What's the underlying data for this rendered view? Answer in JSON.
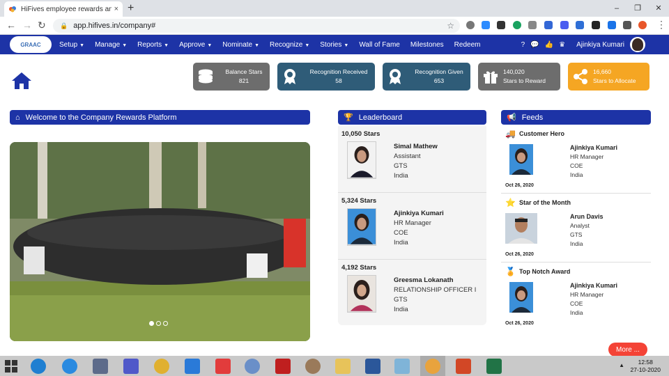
{
  "browser": {
    "tab_title": "HiFives employee rewards and re",
    "tab_close": "×",
    "new_tab": "+",
    "url": "app.hifives.in/company#",
    "window_controls": [
      "–",
      "❐",
      "✕"
    ]
  },
  "nav": {
    "logo_text": "GRAAC",
    "menu": [
      "Setup",
      "Manage",
      "Reports",
      "Approve",
      "Nominate",
      "Recognize",
      "Stories",
      "Wall of Fame",
      "Milestones",
      "Redeem"
    ],
    "menu_with_caret": [
      true,
      true,
      true,
      true,
      true,
      true,
      true,
      false,
      false,
      false
    ],
    "user_name": "Ajinkiya Kumari"
  },
  "stats": [
    {
      "label": "Balance Stars",
      "value": "821",
      "color": "#6d6d6d",
      "icon": "coins-icon"
    },
    {
      "label": "Recognition Received",
      "value": "58",
      "color": "#2f5c78",
      "icon": "award-icon"
    },
    {
      "label": "Recognition Given",
      "value": "653",
      "color": "#2f5c78",
      "icon": "award-icon"
    },
    {
      "label": "140,020",
      "value": "Stars to Reward",
      "color": "#6d6d6d",
      "icon": "gift-icon"
    },
    {
      "label": "16,660",
      "value": "Stars to Allocate",
      "color": "#f5a623",
      "icon": "share-icon"
    }
  ],
  "welcome": {
    "title": "Welcome to the Company Rewards Platform"
  },
  "leaderboard": {
    "title": "Leaderboard",
    "entries": [
      {
        "stars": "10,050 Stars",
        "name": "Simal Mathew",
        "role": "Assistant",
        "dept": "GTS",
        "country": "India"
      },
      {
        "stars": "5,324 Stars",
        "name": "Ajinkiya Kumari",
        "role": "HR Manager",
        "dept": "COE",
        "country": "India"
      },
      {
        "stars": "4,192 Stars",
        "name": "Greesma Lokanath",
        "role": "RELATIONSHIP OFFICER I",
        "dept": "GTS",
        "country": "India"
      }
    ]
  },
  "feeds": {
    "title": "Feeds",
    "items": [
      {
        "award": "Customer Hero",
        "name": "Ajinkiya Kumari",
        "role": "HR Manager",
        "dept": "COE",
        "country": "India",
        "date": "Oct 26, 2020"
      },
      {
        "award": "Star of the Month",
        "name": "Arun Davis",
        "role": "Analyst",
        "dept": "GTS",
        "country": "India",
        "date": "Oct 26, 2020"
      },
      {
        "award": "Top Notch Award",
        "name": "Ajinkiya Kumari",
        "role": "HR Manager",
        "dept": "COE",
        "country": "India",
        "date": "Oct 26, 2020"
      }
    ],
    "more_label": "More ..."
  },
  "taskbar": {
    "time": "12:58",
    "date": "27-10-2020"
  }
}
